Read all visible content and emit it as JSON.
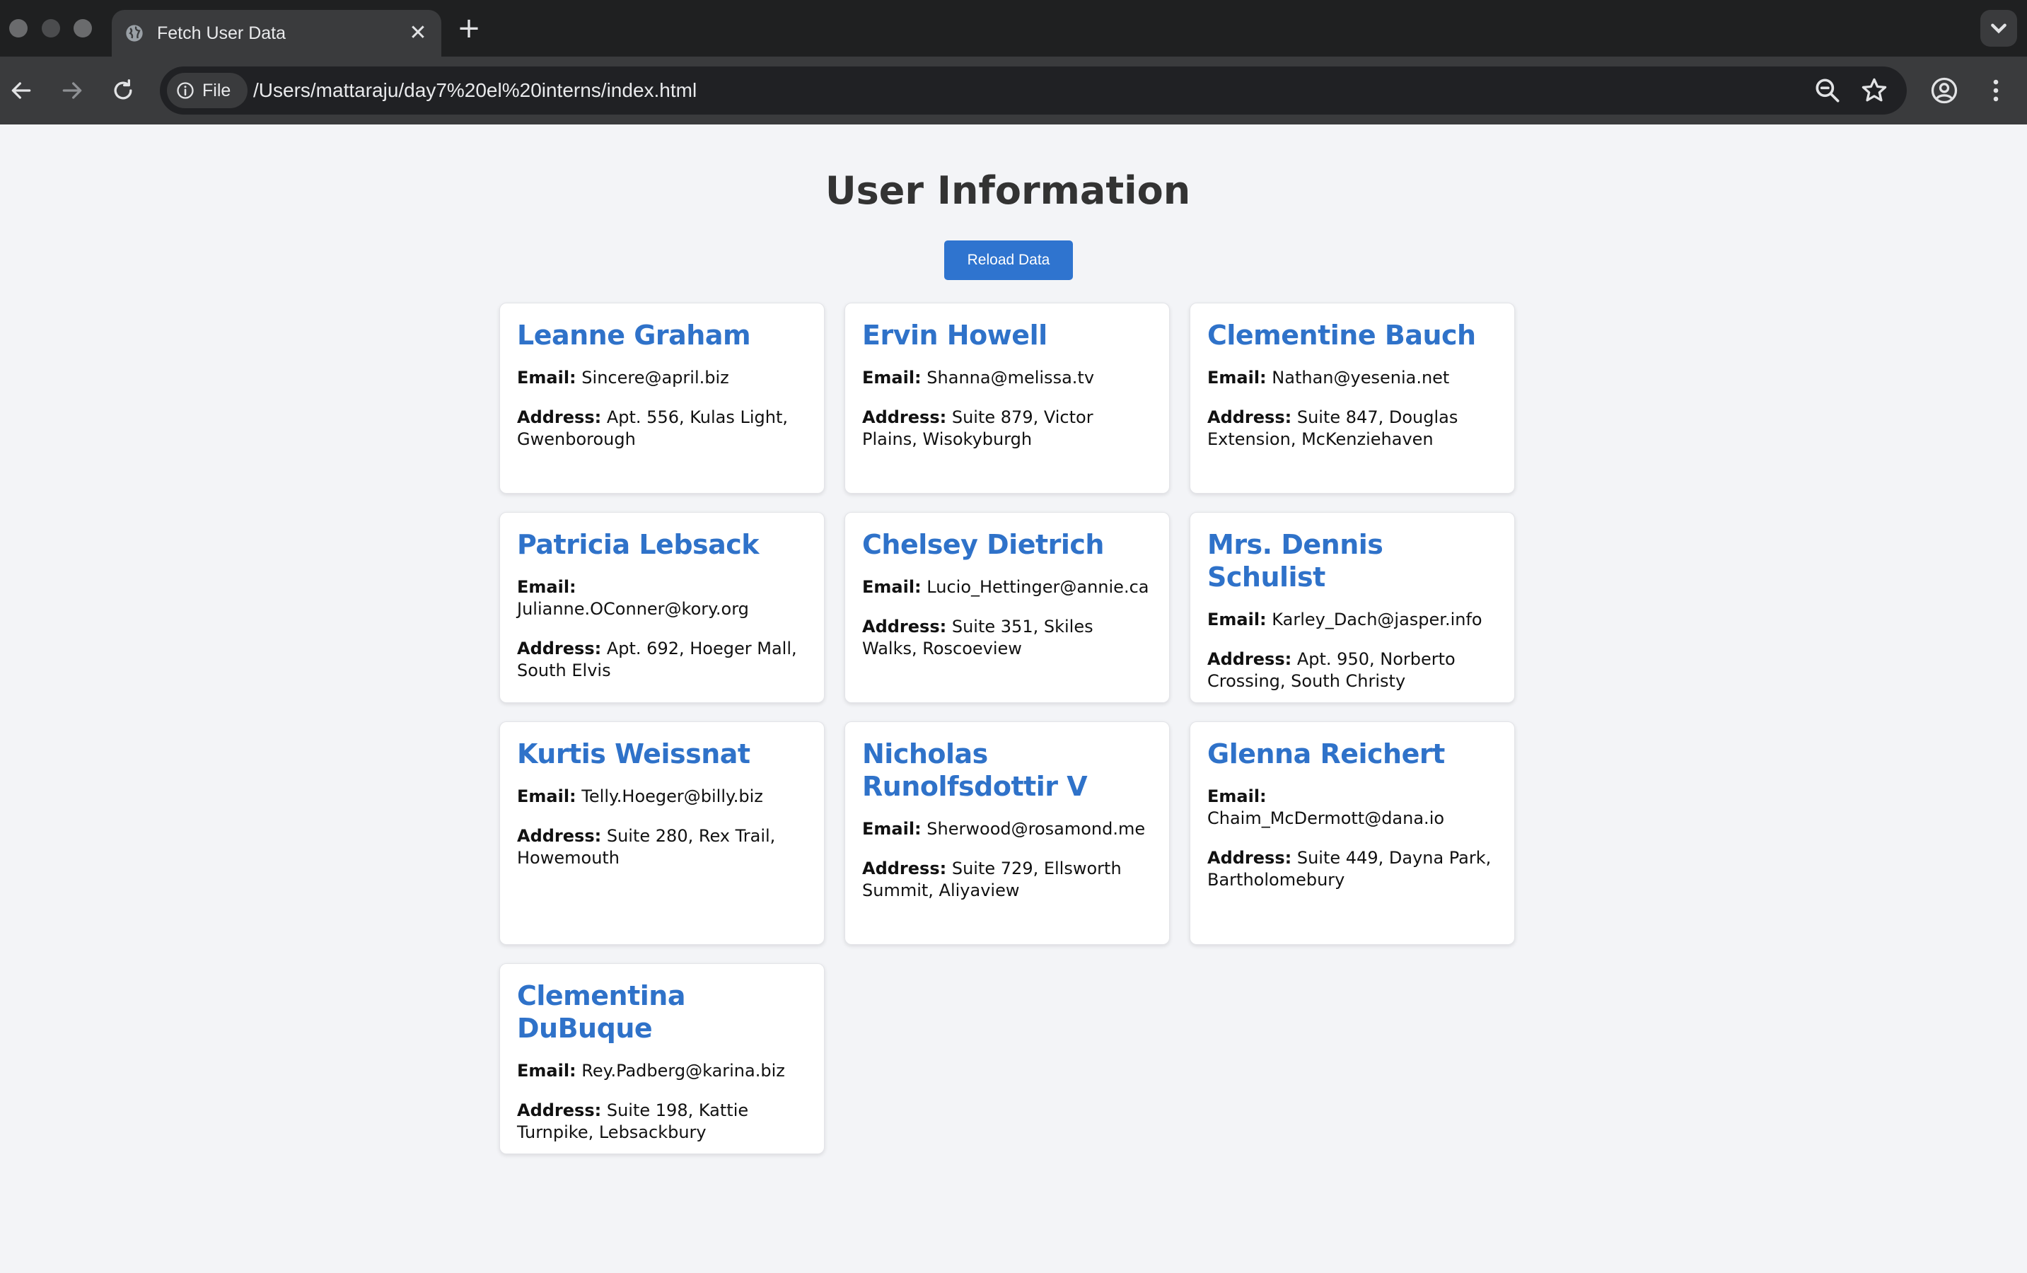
{
  "browser": {
    "tab_title": "Fetch User Data",
    "new_tab_glyph": "+",
    "close_glyph": "✕",
    "site_info_label": "File",
    "url": "/Users/mattaraju/day7%20el%20interns/index.html",
    "icons": [
      "globe-icon",
      "back-icon",
      "forward-icon",
      "reload-icon",
      "info-icon",
      "zoom-icon",
      "star-icon",
      "profile-icon",
      "menu-icon",
      "chevron-down-icon"
    ]
  },
  "page": {
    "title": "User Information",
    "reload_label": "Reload Data",
    "email_label": "Email:",
    "address_label": "Address:",
    "accent_color": "#2f72c9",
    "button_color": "#2f74cf"
  },
  "users": [
    {
      "name": "Leanne Graham",
      "email": "Sincere@april.biz",
      "address": "Apt. 556, Kulas Light, Gwenborough"
    },
    {
      "name": "Ervin Howell",
      "email": "Shanna@melissa.tv",
      "address": "Suite 879, Victor Plains, Wisokyburgh"
    },
    {
      "name": "Clementine Bauch",
      "email": "Nathan@yesenia.net",
      "address": "Suite 847, Douglas Extension, McKenziehaven"
    },
    {
      "name": "Patricia Lebsack",
      "email": "Julianne.OConner@kory.org",
      "address": "Apt. 692, Hoeger Mall, South Elvis"
    },
    {
      "name": "Chelsey Dietrich",
      "email": "Lucio_Hettinger@annie.ca",
      "address": "Suite 351, Skiles Walks, Roscoeview"
    },
    {
      "name": "Mrs. Dennis Schulist",
      "email": "Karley_Dach@jasper.info",
      "address": "Apt. 950, Norberto Crossing, South Christy"
    },
    {
      "name": "Kurtis Weissnat",
      "email": "Telly.Hoeger@billy.biz",
      "address": "Suite 280, Rex Trail, Howemouth"
    },
    {
      "name": "Nicholas Runolfsdottir V",
      "email": "Sherwood@rosamond.me",
      "address": "Suite 729, Ellsworth Summit, Aliyaview"
    },
    {
      "name": "Glenna Reichert",
      "email": "Chaim_McDermott@dana.io",
      "address": "Suite 449, Dayna Park, Bartholomebury"
    },
    {
      "name": "Clementina DuBuque",
      "email": "Rey.Padberg@karina.biz",
      "address": "Suite 198, Kattie Turnpike, Lebsackbury"
    }
  ]
}
